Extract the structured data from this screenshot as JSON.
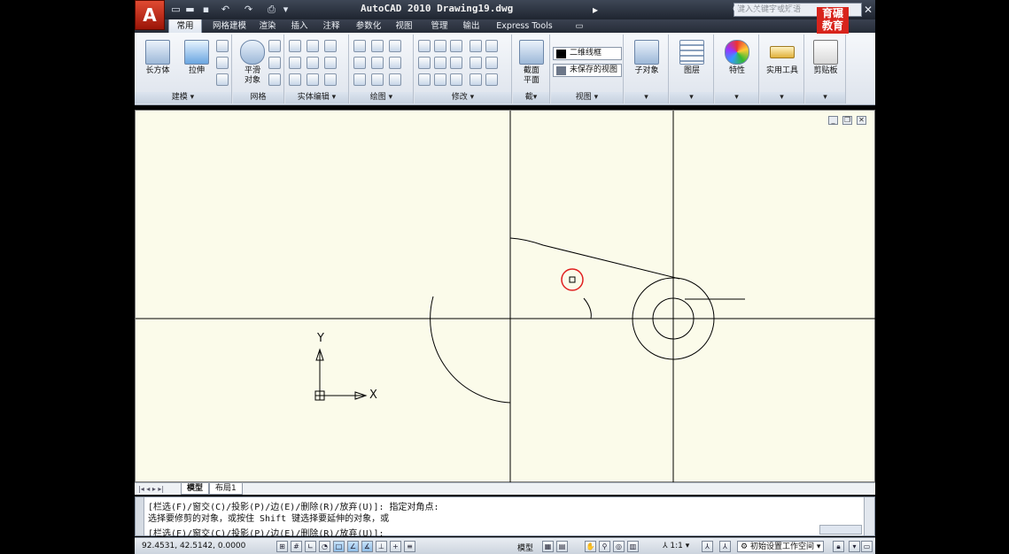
{
  "app": {
    "logo_letter": "A",
    "title": "AutoCAD 2010   Drawing19.dwg",
    "search_placeholder": "键入关键字或短语",
    "brand_text": [
      "育",
      "碾",
      "教",
      "育"
    ]
  },
  "menu_tabs": [
    "常用",
    "网格建模",
    "渲染",
    "插入",
    "注释",
    "参数化",
    "视图",
    "管理",
    "输出",
    "Express Tools"
  ],
  "ribbon": {
    "panels": [
      {
        "label": "建模 ▾",
        "buttons": [
          "长方体",
          "拉伸"
        ]
      },
      {
        "label": "网格",
        "buttons": [
          "平滑\n对象"
        ]
      },
      {
        "label": "实体编辑 ▾",
        "buttons": []
      },
      {
        "label": "绘图 ▾",
        "buttons": []
      },
      {
        "label": "修改 ▾",
        "buttons": []
      },
      {
        "label": "截▾",
        "buttons": [
          "截面\n平面"
        ]
      },
      {
        "label": "视图 ▾",
        "buttons": []
      }
    ],
    "view_dropdowns": [
      "二维线框",
      "未保存的视图"
    ],
    "big_buttons": [
      "子对象",
      "图层",
      "特性",
      "实用工具",
      "剪贴板"
    ]
  },
  "layout_tabs": [
    "模型",
    "布局1"
  ],
  "command": {
    "line1": "[栏选(F)/窗交(C)/投影(P)/边(E)/删除(R)/放弃(U)]:  指定对角点:",
    "line2": "选择要修剪的对象，或按住 Shift 键选择要延伸的对象，或",
    "line3": "[栏选(F)/窗交(C)/投影(P)/边(E)/删除(R)/放弃(U)]:"
  },
  "status": {
    "coords": "92.4531,  42.5142, 0.0000",
    "model_label": "模型",
    "scale_label": "1:1",
    "workspace_label": "初始设置工作空间"
  },
  "ucs": {
    "x_label": "X",
    "y_label": "Y"
  },
  "colors": {
    "canvas_bg": "#fbfbea",
    "cursor_circle": "#e02020",
    "brand_red": "#d8241c",
    "appbutton_red": "#c0321e"
  }
}
